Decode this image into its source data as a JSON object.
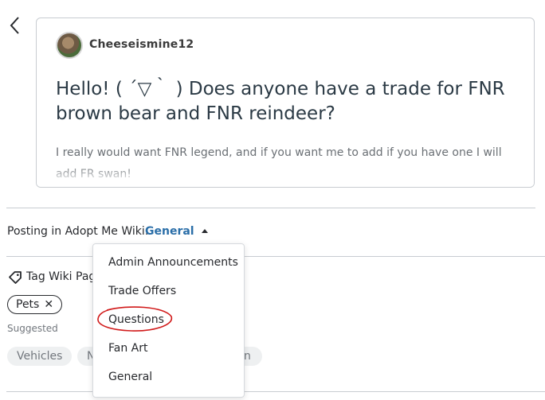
{
  "post": {
    "author": "Cheeseismine12",
    "title": "Hello! ( ´▽｀ ) Does anyone have a trade for FNR brown bear and FNR reindeer?",
    "body": "I really would want FNR legend, and if you want me to add if you have one I will add FR swan!"
  },
  "posting": {
    "label": "Posting in Adopt Me Wiki:",
    "selected": "General"
  },
  "tags": {
    "label": "Tag Wiki Page",
    "selected": [
      "Pets"
    ],
    "remove_glyph": "✕",
    "suggested_label": "Suggested",
    "suggested": [
      "Vehicles",
      "N",
      "n"
    ]
  },
  "dropdown": {
    "options": [
      "Admin Announcements",
      "Trade Offers",
      "Questions",
      "Fan Art",
      "General"
    ],
    "highlighted": "Questions"
  },
  "colors": {
    "link": "#2a6ea8",
    "annotation": "#d11a1a"
  },
  "icons": {
    "back": "chevron-left-icon",
    "tag": "tag-icon",
    "caret": "caret-up-icon"
  }
}
